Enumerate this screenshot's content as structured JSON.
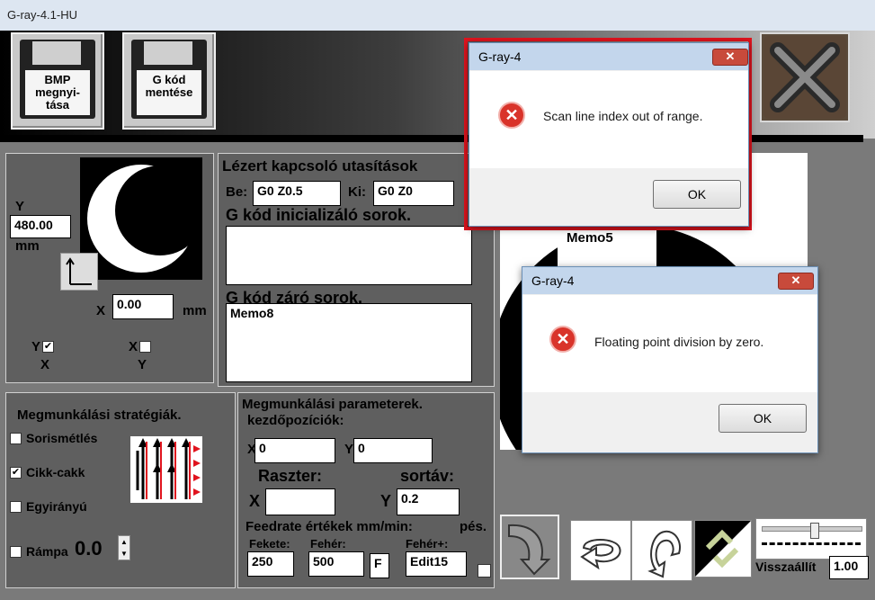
{
  "window": {
    "title": "G-ray-4.1-HU"
  },
  "toolbar": {
    "open_bmp": "BMP megnyi-tása",
    "save_gcode": "G kód mentése"
  },
  "image_panel": {
    "y_label": "Y",
    "y_value": "480.00",
    "y_unit": "mm",
    "x_label": "X",
    "x_value": "0.00",
    "x_unit": "mm",
    "mirror_y_label": "Y",
    "mirror_y_sub": "X",
    "mirror_x_label": "X",
    "mirror_x_sub": "Y"
  },
  "laser": {
    "title": "Lézert kapcsoló utasítások",
    "be_label": "Be:",
    "be_value": "G0 Z0.5",
    "ki_label": "Ki:",
    "ki_value": "G0 Z0",
    "init_title": "G kód inicializáló sorok.",
    "end_title": "G kód záró sorok.",
    "end_memo": "Memo8"
  },
  "preview": {
    "memo": "Memo5"
  },
  "strategy": {
    "title": "Megmunkálási stratégiák.",
    "options": [
      "Sorismétlés",
      "Cikk-cakk",
      "Egyirányú",
      "Rámpa"
    ],
    "checked": [
      false,
      true,
      false,
      false
    ],
    "ramp_value": "0.0"
  },
  "params": {
    "title": "Megmunkálási parameterek.",
    "start_title": "kezdőpozíciók:",
    "x_label": "X",
    "x_value": "0",
    "y_label": "Y",
    "y_value": "0",
    "raster_label": "Raszter:",
    "rowstep_label": "sortáv:",
    "raster_x_label": "X",
    "raster_x_value": "",
    "raster_y_label": "Y",
    "raster_y_value": "0.2",
    "feed_title": "Feedrate értékek mm/min:",
    "feed_title_cont": "pés.",
    "fekete_label": "Fekete:",
    "fekete_value": "250",
    "feher_label": "Fehér:",
    "feher_value": "500",
    "f_label": "F",
    "feherplus_label": "Fehér+:",
    "feherplus_value": "Edit15"
  },
  "bottom": {
    "reset_label": "Visszaállít",
    "zoom_value": "1.00"
  },
  "dialog1": {
    "title": "G-ray-4",
    "message": "Scan line index out of range.",
    "ok": "OK",
    "close": "✕"
  },
  "dialog2": {
    "title": "G-ray-4",
    "message": "Floating point division by zero.",
    "ok": "OK",
    "close": "✕"
  },
  "colors": {
    "highlight": "#e0141e",
    "error": "#d9332a"
  }
}
